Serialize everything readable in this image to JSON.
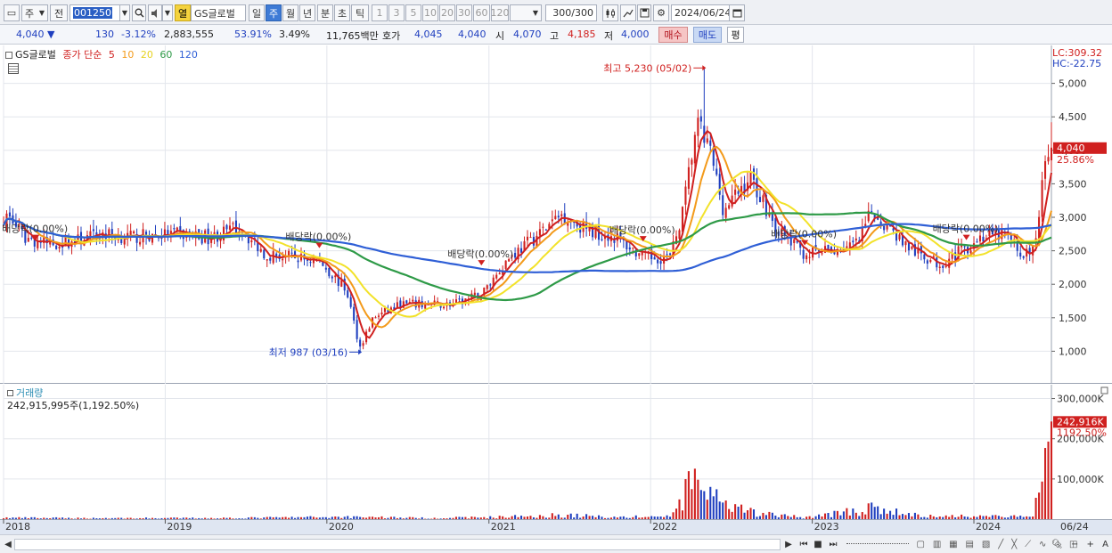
{
  "toolbar": {
    "period_label": "주",
    "prev_label": "전",
    "stock_code": "001250",
    "open_label": "열",
    "stock_name": "GS글로벌",
    "tabs": [
      "일",
      "주",
      "월",
      "년",
      "분",
      "초",
      "틱"
    ],
    "active_tab": "주",
    "numbers": [
      "1",
      "3",
      "5",
      "10",
      "20",
      "30",
      "60",
      "120"
    ],
    "count_value": "300",
    "count_total": "/300",
    "date": "2024/06/24"
  },
  "quote": {
    "price": "4,040",
    "change": "130",
    "change_pct": "-3.12%",
    "volume": "2,883,555",
    "vol_ratio": "53.91%",
    "turnover": "3.49%",
    "amount": "11,765백만",
    "ask_label": "호가",
    "ask": "4,045",
    "bid": "4,040",
    "open_label": "시",
    "open": "4,070",
    "high_label": "고",
    "high": "4,185",
    "low_label": "저",
    "low": "4,000",
    "buy_label": "매수",
    "sell_label": "매도",
    "flat_label": "평"
  },
  "legend": {
    "name": "GS글로벌",
    "type": "종가 단순",
    "ma": [
      "5",
      "10",
      "20",
      "60",
      "120"
    ]
  },
  "lc_label": "LC:309.32",
  "hc_label": "HC:-22.75",
  "volume_panel": {
    "title": "거래량",
    "value": "242,915,995주(1,192.50%)",
    "current_label": "242,916K",
    "current_pct": "1192.50%"
  },
  "colors": {
    "up": "#d0201f",
    "down": "#1f3fbf",
    "ma5": "#d0201f",
    "ma10": "#f39a1a",
    "ma20": "#f2e22a",
    "ma60": "#2e9a47",
    "ma120": "#2f5fd6"
  },
  "chart_data": {
    "type": "candlestick",
    "price_axis": [
      "5,000",
      "4,500",
      "4,000",
      "3,500",
      "3,000",
      "2,500",
      "2,000",
      "1,500",
      "1,000"
    ],
    "price_ticks": [
      5000,
      4500,
      4000,
      3500,
      3000,
      2500,
      2000,
      1500,
      1000
    ],
    "ylim": [
      540,
      5540
    ],
    "volume_axis": [
      "300,000K",
      "200,000K",
      "100,000K"
    ],
    "volume_ticks": [
      300000,
      200000,
      100000
    ],
    "volume_ylim": [
      0,
      330000
    ],
    "x_labels": [
      "2018",
      "2019",
      "2020",
      "2021",
      "2022",
      "2023",
      "2024",
      "06/24"
    ],
    "x_label_dates": [
      "2018-01",
      "2019-01",
      "2020-01",
      "2021-01",
      "2022-01",
      "2023-01",
      "2024-01",
      "2024-06"
    ],
    "current_price_label": "4,040",
    "current_price": 4040,
    "current_pct_label": "25.86%",
    "annotations": [
      {
        "text": "최고 5,230 (05/02)",
        "kind": "high",
        "date": "2022-05-02",
        "value": 5230
      },
      {
        "text": "최저 987 (03/16)",
        "kind": "low",
        "date": "2020-03-16",
        "value": 987
      }
    ],
    "dividend_marks": [
      {
        "text": "배당락(0.00%)",
        "date": "2018-03",
        "value": 2660
      },
      {
        "text": "배당락(0.00%)",
        "date": "2019-12",
        "value": 2540
      },
      {
        "text": "배당락(0.00%)",
        "date": "2020-12",
        "value": 2280
      },
      {
        "text": "배당락(0.00%)",
        "date": "2021-12",
        "value": 2640
      },
      {
        "text": "배당락(0.00%)",
        "date": "2022-12",
        "value": 2580
      },
      {
        "text": "배당락(0.00%)",
        "date": "2023-12",
        "value": 2660
      }
    ],
    "close_anchors": [
      [
        "2018-01",
        3000
      ],
      [
        "2018-02",
        2700
      ],
      [
        "2018-04",
        2600
      ],
      [
        "2018-06",
        2650
      ],
      [
        "2018-08",
        2750
      ],
      [
        "2018-10",
        2700
      ],
      [
        "2019-01",
        2750
      ],
      [
        "2019-04",
        2700
      ],
      [
        "2019-06",
        2850
      ],
      [
        "2019-08",
        2450
      ],
      [
        "2019-10",
        2400
      ],
      [
        "2019-12",
        2350
      ],
      [
        "2020-02",
        1900
      ],
      [
        "2020-03",
        1050
      ],
      [
        "2020-04",
        1500
      ],
      [
        "2020-06",
        1700
      ],
      [
        "2020-08",
        1700
      ],
      [
        "2020-10",
        1700
      ],
      [
        "2020-12",
        1850
      ],
      [
        "2021-02",
        2400
      ],
      [
        "2021-04",
        2700
      ],
      [
        "2021-06",
        3050
      ],
      [
        "2021-08",
        2800
      ],
      [
        "2021-10",
        2700
      ],
      [
        "2021-12",
        2400
      ],
      [
        "2022-02",
        2400
      ],
      [
        "2022-03",
        3100
      ],
      [
        "2022-04",
        4400
      ],
      [
        "2022-05",
        4000
      ],
      [
        "2022-06",
        3100
      ],
      [
        "2022-08",
        3600
      ],
      [
        "2022-10",
        2800
      ],
      [
        "2022-12",
        2450
      ],
      [
        "2023-02",
        2500
      ],
      [
        "2023-04",
        2600
      ],
      [
        "2023-05",
        3100
      ],
      [
        "2023-06",
        2900
      ],
      [
        "2023-08",
        2500
      ],
      [
        "2023-10",
        2300
      ],
      [
        "2023-12",
        2550
      ],
      [
        "2024-01",
        2700
      ],
      [
        "2024-03",
        2750
      ],
      [
        "2024-04",
        2450
      ],
      [
        "2024-05",
        2500
      ],
      [
        "2024-06",
        4040
      ]
    ],
    "volume_anchors": [
      [
        "2018-01",
        4000
      ],
      [
        "2018-06",
        3000
      ],
      [
        "2019-01",
        3000
      ],
      [
        "2019-06",
        3500
      ],
      [
        "2020-03",
        7000
      ],
      [
        "2020-08",
        3000
      ],
      [
        "2021-01",
        6000
      ],
      [
        "2021-06",
        12000
      ],
      [
        "2021-10",
        6000
      ],
      [
        "2022-02",
        8000
      ],
      [
        "2022-04",
        120000
      ],
      [
        "2022-06",
        35000
      ],
      [
        "2022-09",
        15000
      ],
      [
        "2022-12",
        5000
      ],
      [
        "2023-05",
        30000
      ],
      [
        "2023-09",
        8000
      ],
      [
        "2024-01",
        10000
      ],
      [
        "2024-05",
        6000
      ],
      [
        "2024-06",
        242916
      ]
    ],
    "series": [
      {
        "name": "5",
        "period": 5
      },
      {
        "name": "10",
        "period": 10
      },
      {
        "name": "20",
        "period": 20
      },
      {
        "name": "60",
        "period": 60
      },
      {
        "name": "120",
        "period": 120
      }
    ]
  }
}
